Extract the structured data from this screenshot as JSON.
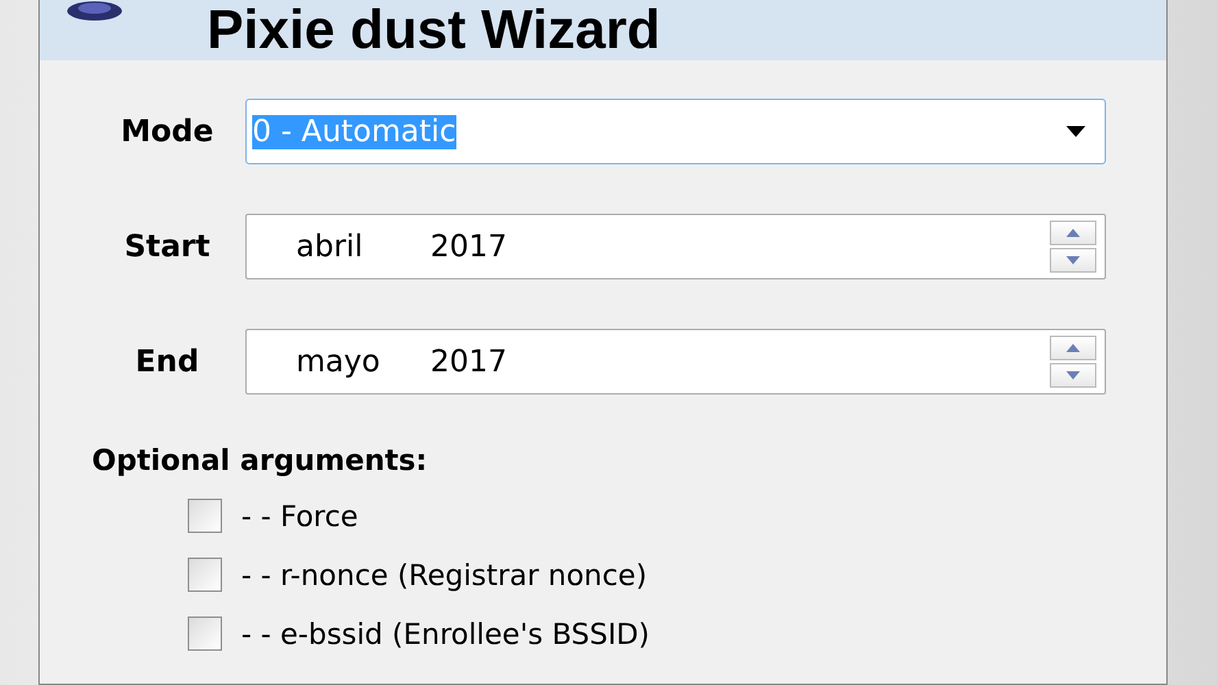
{
  "window": {
    "title": "Pixie dust Wizard"
  },
  "mode": {
    "label": "Mode",
    "value": "0 - Automatic",
    "text_selected": true
  },
  "date_fields": [
    {
      "label": "Start",
      "month": "abril",
      "year": "2017"
    },
    {
      "label": "End",
      "month": "mayo",
      "year": "2017"
    }
  ],
  "optional_arguments": {
    "heading": "Optional arguments:",
    "options": [
      {
        "label": "- - Force",
        "checked": false
      },
      {
        "label": "- - r-nonce (Registrar nonce)",
        "checked": false
      },
      {
        "label": "- - e-bssid (Enrollee's BSSID)",
        "checked": false
      }
    ]
  }
}
